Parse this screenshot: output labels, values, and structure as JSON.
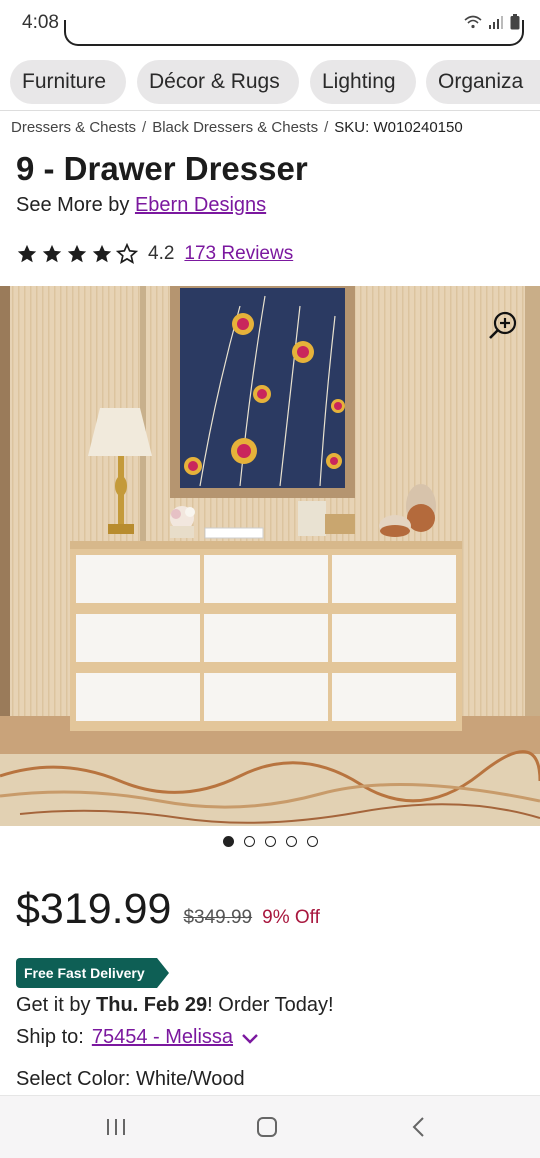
{
  "status": {
    "time": "4:08"
  },
  "categories": [
    {
      "label": "Furniture"
    },
    {
      "label": "Décor & Rugs"
    },
    {
      "label": "Lighting"
    },
    {
      "label": "Organiza"
    }
  ],
  "breadcrumb": {
    "items": [
      "Dressers & Chests",
      "Black Dressers & Chests"
    ],
    "separator": "/",
    "sku": "SKU: W010240150"
  },
  "product": {
    "title": "9 - Drawer Dresser",
    "see_more_prefix": "See More by",
    "brand": "Ebern Designs",
    "rating": "4.2",
    "rating_value": 4.2,
    "reviews": "173 Reviews",
    "price": "$319.99",
    "old_price": "$349.99",
    "discount": "9% Off",
    "image_count": 5,
    "image_active_index": 0
  },
  "delivery": {
    "badge": "Free Fast Delivery",
    "get_it_prefix": "Get it by",
    "date": "Thu. Feb 29",
    "get_it_suffix": "! Order Today!",
    "ship_to_label": "Ship to:",
    "ship_to_value": "75454 - Melissa"
  },
  "color": {
    "label": "Select Color: White/Wood"
  },
  "colors": {
    "brand_purple": "#7b189f",
    "badge_teal": "#0e5f55",
    "discount_red": "#a8173e"
  },
  "icons": [
    "wifi-icon",
    "signal-icon",
    "battery-icon",
    "star-icon",
    "zoom-in-icon",
    "chevron-down-icon",
    "recent-apps-icon",
    "home-icon",
    "back-icon"
  ]
}
